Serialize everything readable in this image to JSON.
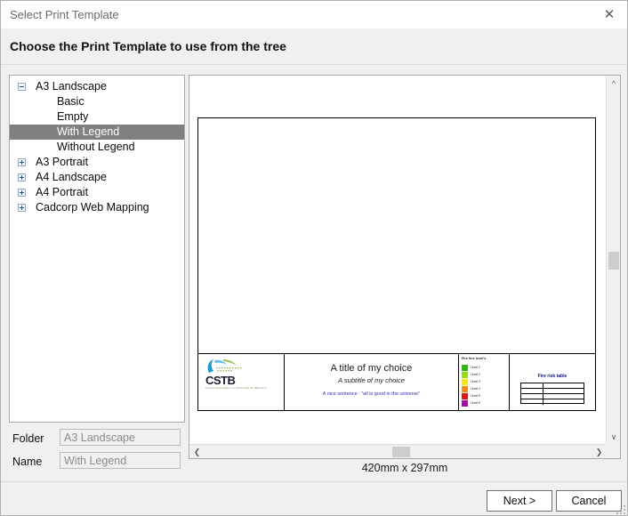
{
  "window": {
    "title": "Select Print Template",
    "close_icon": "close-icon"
  },
  "header": {
    "instruction": "Choose the Print Template to use from the tree"
  },
  "tree": {
    "nodes": [
      {
        "label": "A3 Landscape",
        "level": 0,
        "expander": "minus",
        "selected": false
      },
      {
        "label": "Basic",
        "level": 1,
        "expander": "none",
        "selected": false
      },
      {
        "label": "Empty",
        "level": 1,
        "expander": "none",
        "selected": false
      },
      {
        "label": "With Legend",
        "level": 1,
        "expander": "none",
        "selected": true
      },
      {
        "label": "Without Legend",
        "level": 1,
        "expander": "none",
        "selected": false
      },
      {
        "label": "A3 Portrait",
        "level": 0,
        "expander": "plus",
        "selected": false
      },
      {
        "label": "A4 Landscape",
        "level": 0,
        "expander": "plus",
        "selected": false
      },
      {
        "label": "A4 Portrait",
        "level": 0,
        "expander": "plus",
        "selected": false
      },
      {
        "label": "Cadcorp Web Mapping",
        "level": 0,
        "expander": "plus",
        "selected": false
      }
    ]
  },
  "fields": {
    "folder_label": "Folder",
    "folder_value": "A3 Landscape",
    "name_label": "Name",
    "name_value": "With Legend"
  },
  "preview": {
    "dimensions": "420mm x 297mm",
    "titleblock": {
      "logo_text": "CSTB",
      "logo_tagline": "Centre Scientifique et Technique du Bâtiment",
      "main_title": "A title of my choice",
      "subtitle": "A subtitle of my choice",
      "sentence": "A nice sentence : \"all is good in the universe\"",
      "legend_title": "Fire line level's",
      "legend_items": [
        {
          "color": "#22c000",
          "text": "Level 1"
        },
        {
          "color": "#8ee000",
          "text": "Level 2"
        },
        {
          "color": "#ffe400",
          "text": "Level 3"
        },
        {
          "color": "#ff8c00",
          "text": "Level 4"
        },
        {
          "color": "#ee1010",
          "text": "Level 5"
        },
        {
          "color": "#b000b0",
          "text": "Level 6"
        }
      ],
      "table_heading": "Fire risk table"
    },
    "scrollbars": {
      "up_arrow": "chevron-up-icon",
      "down_arrow": "chevron-down-icon",
      "left_arrow": "chevron-left-icon",
      "right_arrow": "chevron-right-icon"
    }
  },
  "footer": {
    "next_label": "Next >",
    "cancel_label": "Cancel"
  }
}
